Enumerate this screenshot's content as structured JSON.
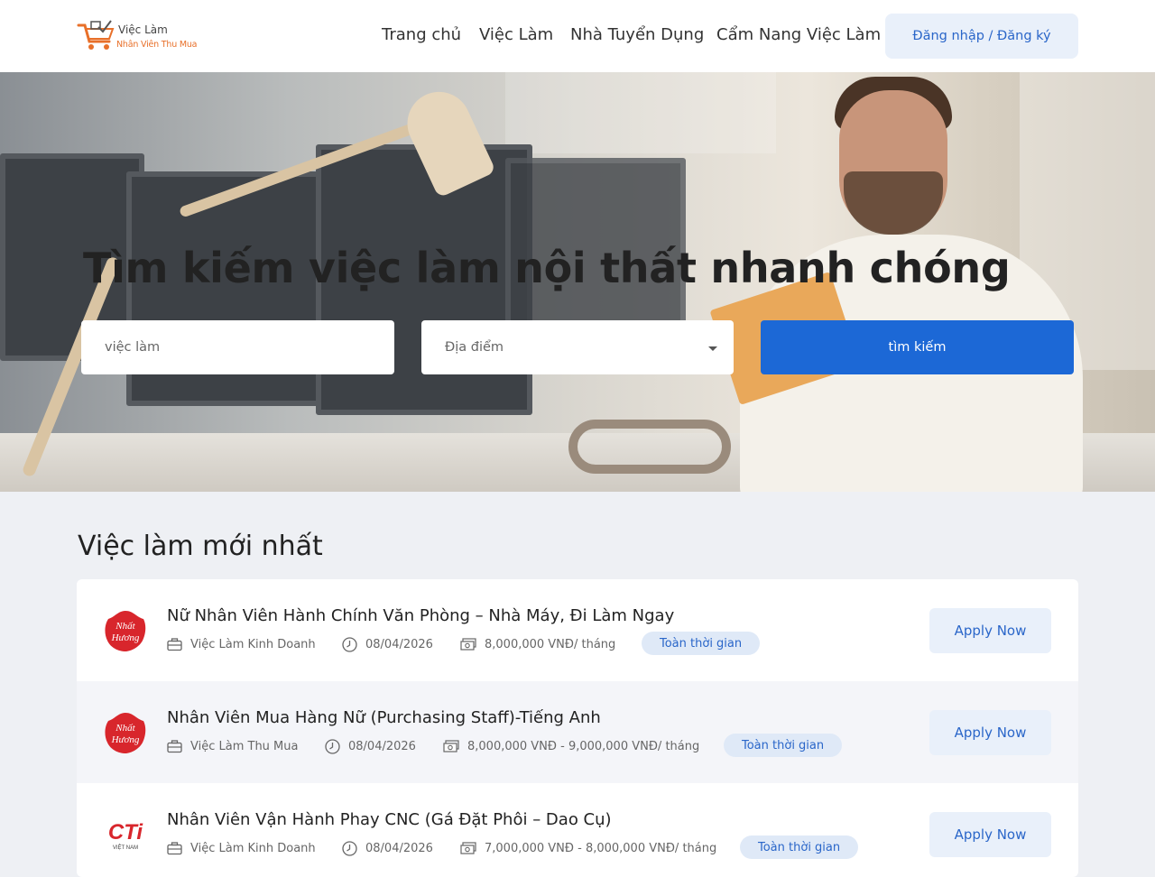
{
  "header": {
    "logo": {
      "line1": "Việc Làm",
      "line2": "Nhân Viên Thu Mua"
    },
    "nav": [
      "Trang chủ",
      "Việc Làm",
      "Nhà Tuyển Dụng",
      "Cẩm Nang Việc Làm"
    ],
    "login_label": "Đăng nhập / Đăng ký"
  },
  "hero": {
    "title": "Tìm kiếm việc làm nội thất nhanh chóng",
    "search_placeholder": "việc làm",
    "location_placeholder": "Địa điểm",
    "search_button": "tìm kiếm"
  },
  "jobs_section": {
    "title": "Việc làm mới nhất",
    "jobs": [
      {
        "logo": "nhat-huong-logo",
        "title": "Nữ Nhân Viên Hành Chính Văn Phòng – Nhà Máy, Đi Làm Ngay",
        "category": "Việc Làm Kinh Doanh",
        "date": "08/04/2026",
        "salary": "8,000,000 VNĐ/ tháng",
        "type": "Toàn thời gian",
        "apply_label": "Apply Now"
      },
      {
        "logo": "nhat-huong-logo",
        "title": "Nhân Viên Mua Hàng Nữ (Purchasing Staff)-Tiếng Anh",
        "category": "Việc Làm Thu Mua",
        "date": "08/04/2026",
        "salary": "8,000,000 VNĐ - 9,000,000 VNĐ/ tháng",
        "type": "Toàn thời gian",
        "apply_label": "Apply Now"
      },
      {
        "logo": "cti-vietnam-logo",
        "title": "Nhân Viên Vận Hành Phay CNC (Gá Đặt Phôi – Dao Cụ)",
        "category": "Việc Làm Kinh Doanh",
        "date": "08/04/2026",
        "salary": "7,000,000 VNĐ - 8,000,000 VNĐ/ tháng",
        "type": "Toàn thời gian",
        "apply_label": "Apply Now"
      }
    ]
  },
  "logo_text": {
    "nhat_huong": "Nhất Hương",
    "cti": "CTi",
    "cti_sub": "VIỆT NAM"
  },
  "colors": {
    "primary": "#1c68d6",
    "accent": "#e8702a",
    "badge_bg": "#dfe9f7",
    "logo_red": "#d8262c"
  },
  "icons": [
    "cart-icon",
    "briefcase-icon",
    "clock-icon",
    "money-icon",
    "caret-down-icon"
  ]
}
